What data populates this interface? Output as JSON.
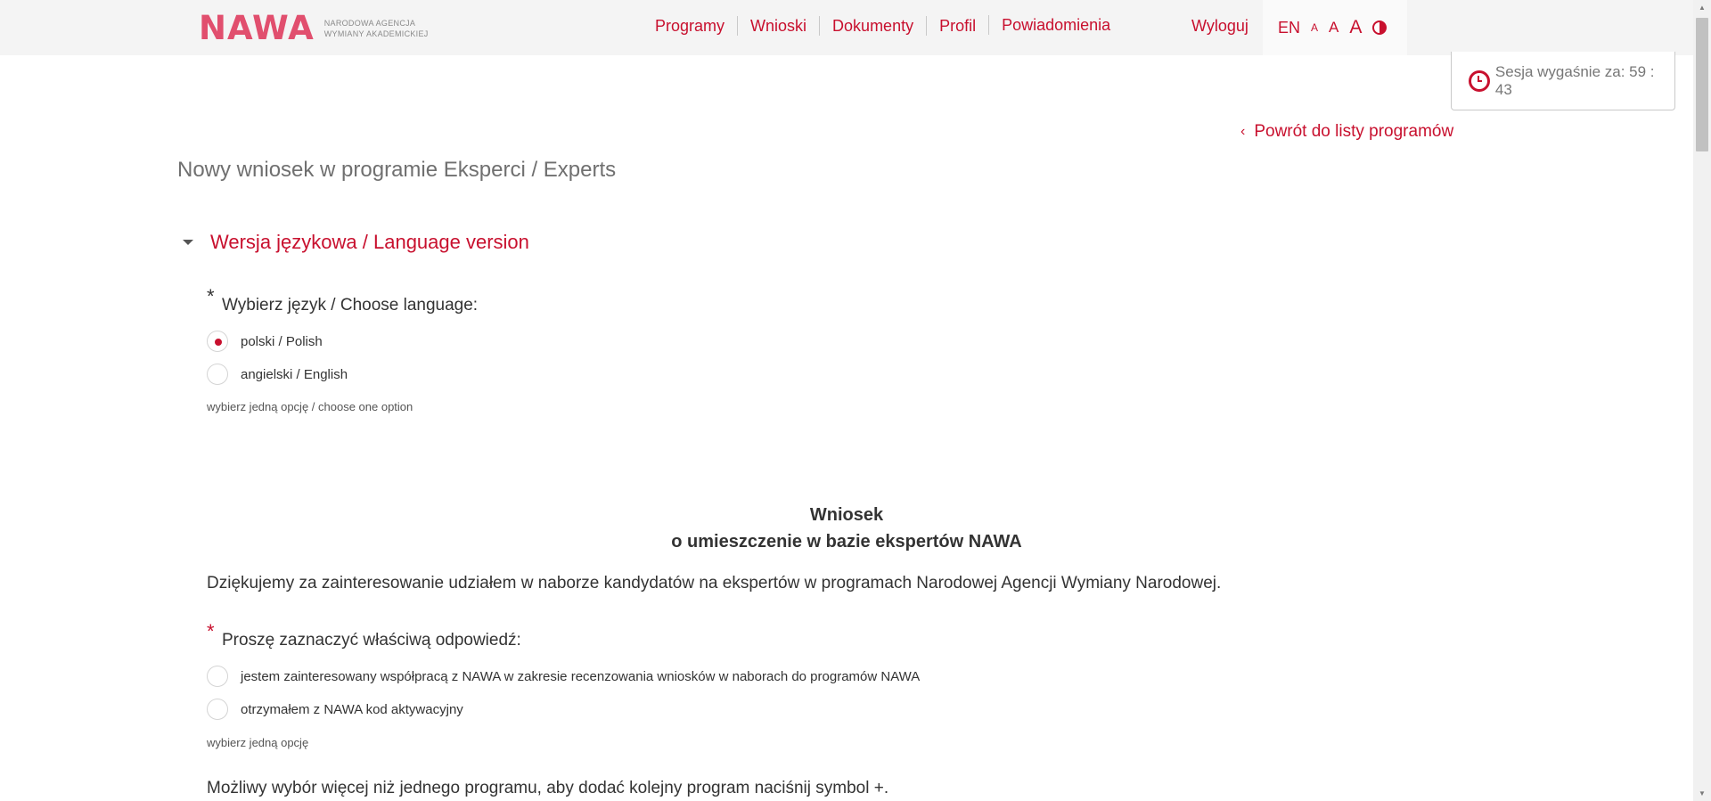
{
  "header": {
    "logo_text": "NAWA",
    "logo_sub_line1": "NARODOWA AGENCJA",
    "logo_sub_line2": "WYMIANY AKADEMICKIEJ",
    "nav": [
      "Programy",
      "Wnioski",
      "Dokumenty",
      "Profil",
      "Powiadomienia"
    ],
    "logout": "Wyloguj",
    "lang": "EN",
    "font_small": "A",
    "font_medium": "A",
    "font_large": "A"
  },
  "session": {
    "label": "Sesja wygaśnie za: 59 : 43"
  },
  "back_link": {
    "chevron": "‹",
    "label": "Powrót do listy programów"
  },
  "page_title": "Nowy wniosek w programie Eksperci / Experts",
  "language_section": {
    "title": "Wersja językowa / Language version",
    "question": "Wybierz język / Choose language:",
    "options": [
      "polski / Polish",
      "angielski / English"
    ],
    "selected": "polski / Polish",
    "hint": "wybierz jedną opcję / choose one option"
  },
  "application": {
    "title_line1": "Wniosek",
    "title_line2": "o umieszczenie w bazie ekspertów NAWA",
    "intro": "Dziękujemy za zainteresowanie udziałem w naborze kandydatów na ekspertów w programach Narodowej Agencji Wymiany Narodowej.",
    "question": "Proszę zaznaczyć właściwą odpowiedź:",
    "options": [
      "jestem zainteresowany współpracą z NAWA w zakresie recenzowania wniosków w naborach do programów NAWA",
      "otrzymałem z NAWA kod aktywacyjny"
    ],
    "hint": "wybierz jedną opcję",
    "note": "Możliwy wybór więcej niż jednego programu, aby dodać kolejny program naciśnij symbol +."
  },
  "required_marker": "*",
  "colors": {
    "accent": "#c8102e",
    "logo": "#e14f6e",
    "header_bg": "#f4f4f4"
  }
}
